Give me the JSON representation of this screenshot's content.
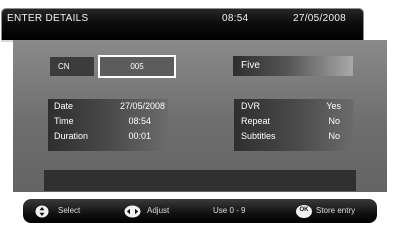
{
  "header": {
    "title": "ENTER DETAILS",
    "time": "08:54",
    "date": "27/05/2008"
  },
  "channel": {
    "label": "CN",
    "number": "005",
    "name": "Five"
  },
  "left_details": [
    {
      "label": "Date",
      "value": "27/05/2008"
    },
    {
      "label": "Time",
      "value": "08:54"
    },
    {
      "label": "Duration",
      "value": "00:01"
    }
  ],
  "right_details": [
    {
      "label": "DVR",
      "value": "Yes"
    },
    {
      "label": "Repeat",
      "value": "No"
    },
    {
      "label": "Subtitles",
      "value": "No"
    }
  ],
  "footer": {
    "select": "Select",
    "adjust": "Adjust",
    "use": "Use 0 - 9",
    "store": "Store entry",
    "ok_icon_text": "OK"
  },
  "icons": [
    "select-icon",
    "adjust-icon",
    "ok-icon"
  ]
}
